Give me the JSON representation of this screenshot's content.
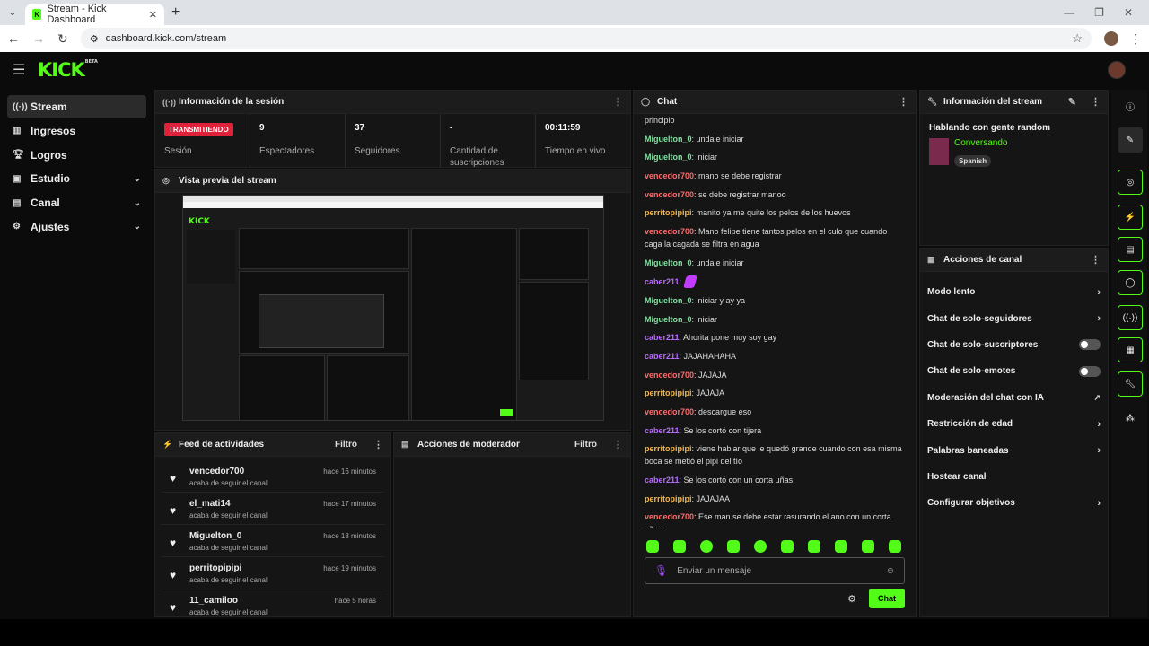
{
  "browser": {
    "tab_title": "Stream - Kick Dashboard",
    "url": "dashboard.kick.com/stream"
  },
  "app": {
    "logo": "KICK",
    "logo_badge": "BETA"
  },
  "sidebar": {
    "items": [
      {
        "label": "Stream",
        "icon": "broadcast-icon"
      },
      {
        "label": "Ingresos",
        "icon": "chart-icon"
      },
      {
        "label": "Logros",
        "icon": "trophy-icon"
      },
      {
        "label": "Estudio",
        "icon": "studio-icon"
      },
      {
        "label": "Canal",
        "icon": "channel-icon"
      },
      {
        "label": "Ajustes",
        "icon": "gear-icon"
      }
    ]
  },
  "session": {
    "title": "Información de la sesión",
    "stats": [
      {
        "value": "TRANSMITIENDO",
        "label": "Sesión"
      },
      {
        "value": "9",
        "label": "Espectadores"
      },
      {
        "value": "37",
        "label": "Seguidores"
      },
      {
        "value": "-",
        "label": "Cantidad de suscripciones"
      },
      {
        "value": "00:11:59",
        "label": "Tiempo en vivo"
      }
    ]
  },
  "preview": {
    "title": "Vista previa del stream"
  },
  "feed": {
    "title": "Feed de actividades",
    "filter": "Filtro",
    "items": [
      {
        "name": "vencedor700",
        "action": "acaba de seguir el canal",
        "time": "hace 16 minutos"
      },
      {
        "name": "el_mati14",
        "action": "acaba de seguir el canal",
        "time": "hace 17 minutos"
      },
      {
        "name": "Miguelton_0",
        "action": "acaba de seguir el canal",
        "time": "hace 18 minutos"
      },
      {
        "name": "perritopipipi",
        "action": "acaba de seguir el canal",
        "time": "hace 19 minutos"
      },
      {
        "name": "11_camiloo",
        "action": "acaba de seguir el canal",
        "time": "hace 5 horas"
      }
    ]
  },
  "moderator": {
    "title": "Acciones de moderador",
    "filter": "Filtro"
  },
  "chat": {
    "title": "Chat",
    "messages": [
      {
        "user": "",
        "text": "principio",
        "color": "#dddddd"
      },
      {
        "user": "Miguelton_0",
        "text": ": undale iniciar",
        "color": "#7fe0a0"
      },
      {
        "user": "Miguelton_0",
        "text": ": iniciar",
        "color": "#7fe0a0"
      },
      {
        "user": "vencedor700",
        "text": ": mano se debe registrar",
        "color": "#ff6b6b"
      },
      {
        "user": "vencedor700",
        "text": ": se debe registrar manoo",
        "color": "#ff6b6b"
      },
      {
        "user": "perritopipipi",
        "text": ": manito ya me quite los pelos de los huevos",
        "color": "#f5b84a"
      },
      {
        "user": "vencedor700",
        "text": ": Mano felipe tiene tantos pelos en el culo que cuando caga la cagada se filtra en agua",
        "color": "#ff6b6b"
      },
      {
        "user": "Miguelton_0",
        "text": ": undale iniciar",
        "color": "#7fe0a0"
      },
      {
        "user": "caber211",
        "text": ":",
        "color": "#b76bff"
      },
      {
        "user": "Miguelton_0",
        "text": ": iniciar y ay ya",
        "color": "#7fe0a0"
      },
      {
        "user": "Miguelton_0",
        "text": ": iniciar",
        "color": "#7fe0a0"
      },
      {
        "user": "caber211",
        "text": ": Ahorita pone muy soy gay",
        "color": "#b76bff"
      },
      {
        "user": "caber211",
        "text": ": JAJAHAHAHA",
        "color": "#b76bff"
      },
      {
        "user": "vencedor700",
        "text": ": JAJAJA",
        "color": "#ff6b6b"
      },
      {
        "user": "perritopipipi",
        "text": ": JAJAJA",
        "color": "#f5b84a"
      },
      {
        "user": "vencedor700",
        "text": ": descargue eso",
        "color": "#ff6b6b"
      },
      {
        "user": "caber211",
        "text": ": Se los cortó con tijera",
        "color": "#b76bff"
      },
      {
        "user": "perritopipipi",
        "text": ": viene hablar que le quedó grande cuando con esa misma boca se metió el pipi del tío",
        "color": "#f5b84a"
      },
      {
        "user": "caber211",
        "text": ": Se los cortó con un corta uñas",
        "color": "#b76bff"
      },
      {
        "user": "perritopipipi",
        "text": ": JAJAJAA",
        "color": "#f5b84a"
      },
      {
        "user": "vencedor700",
        "text": ": Ese man se debe estar rasurando el ano con un corta uñas",
        "color": "#ff6b6b"
      }
    ],
    "input_placeholder": "Enviar un mensaje",
    "send_label": "Chat"
  },
  "stream_info": {
    "title": "Información del stream",
    "stream_title": "Hablando con gente random",
    "category": "Conversando",
    "language": "Spanish"
  },
  "channel_actions": {
    "title": "Acciones de canal",
    "items": [
      {
        "label": "Modo lento",
        "control": "chevron"
      },
      {
        "label": "Chat de solo-seguidores",
        "control": "chevron"
      },
      {
        "label": "Chat de solo-suscriptores",
        "control": "toggle"
      },
      {
        "label": "Chat de solo-emotes",
        "control": "toggle"
      },
      {
        "label": "Moderación del chat con IA",
        "control": "external"
      },
      {
        "label": "Restricción de edad",
        "control": "chevron"
      },
      {
        "label": "Palabras baneadas",
        "control": "chevron"
      },
      {
        "label": "Hostear canal",
        "control": "none"
      },
      {
        "label": "Configurar objetivos",
        "control": "chevron"
      }
    ]
  }
}
